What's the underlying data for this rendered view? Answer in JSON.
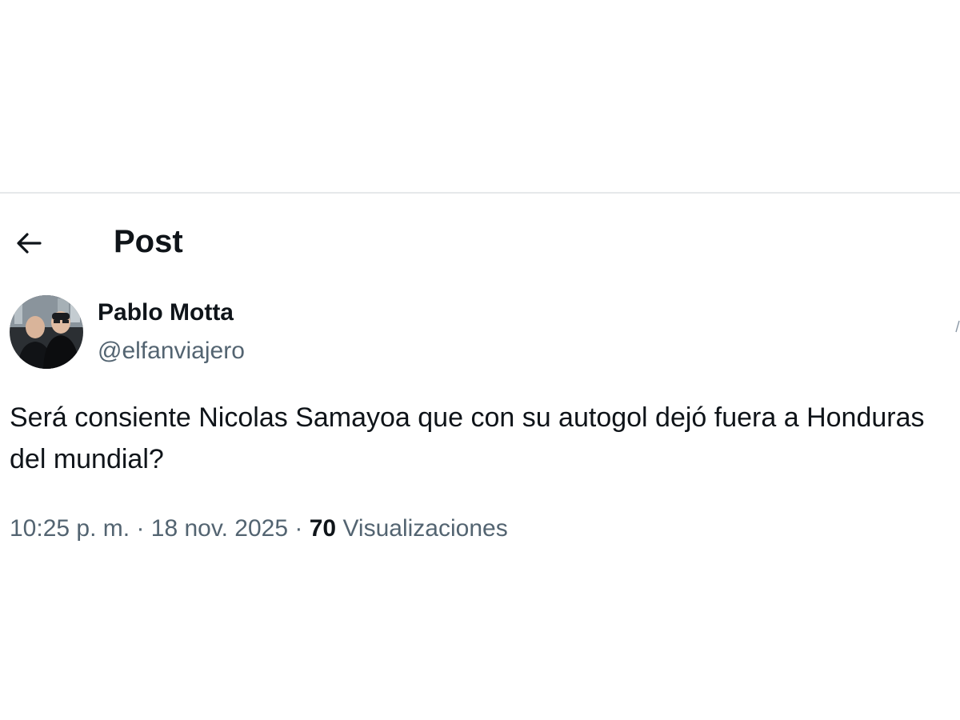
{
  "header": {
    "title": "Post",
    "back_icon": "arrow-left-icon"
  },
  "post": {
    "author": {
      "name": "Pablo Motta",
      "handle": "@elfanviajero"
    },
    "text": "Será consiente Nicolas Samayoa que con su autogol dejó fuera a Honduras del mundial?",
    "meta": {
      "time": "10:25 p. m.",
      "separator": "·",
      "date": "18 nov. 2025",
      "views_count": "70",
      "views_label": "Visualizaciones"
    }
  },
  "colors": {
    "text_primary": "#0f1419",
    "text_secondary": "#536471",
    "divider": "#e6e8ea"
  }
}
